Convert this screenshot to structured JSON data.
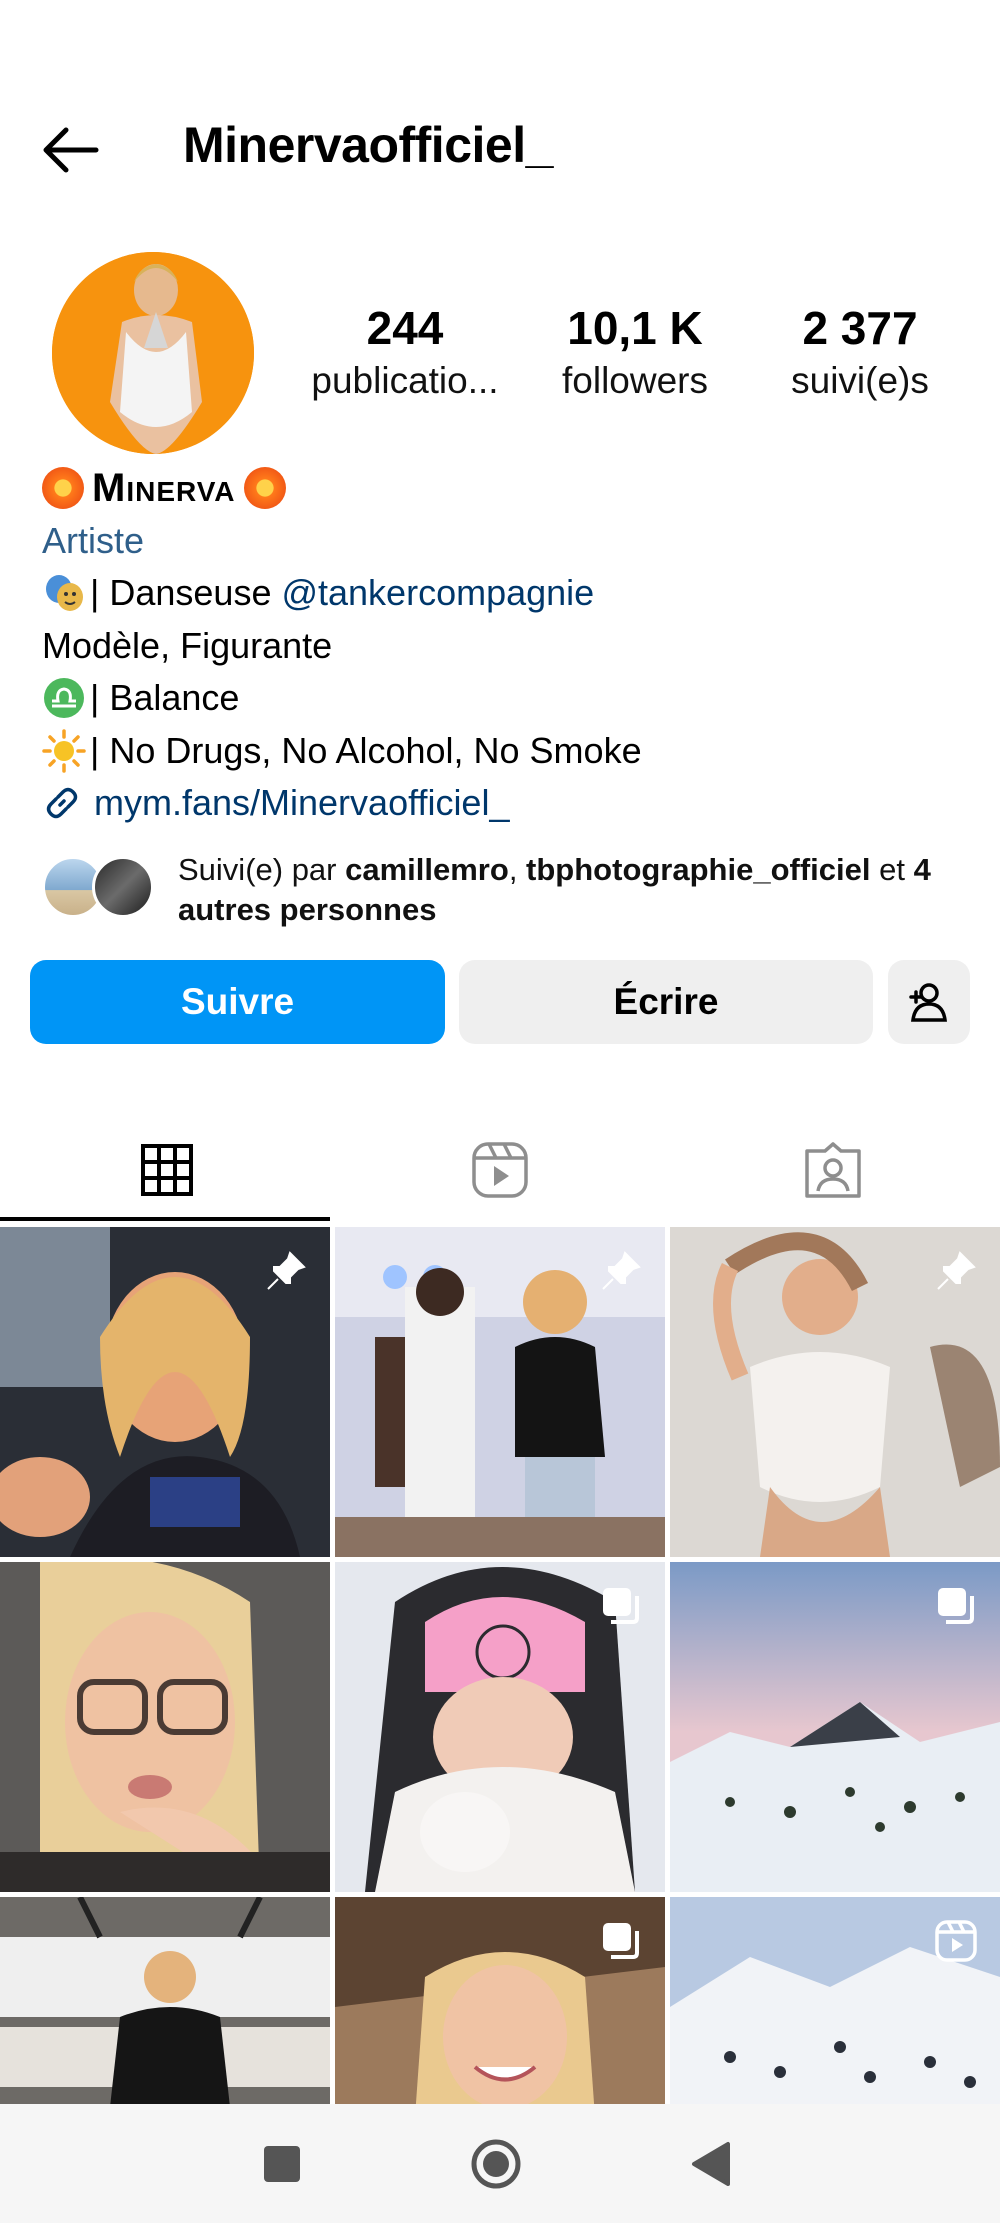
{
  "header": {
    "username": "Minervaofficiel_"
  },
  "stats": [
    {
      "value": "244",
      "label": "publicatio..."
    },
    {
      "value": "10,1 K",
      "label": "followers"
    },
    {
      "value": "2 377",
      "label": "suivi(e)s"
    }
  ],
  "bio": {
    "name": "Minerva",
    "category": "Artiste",
    "line1_text": "| Danseuse ",
    "line1_mention": "@tankercompagnie",
    "line2": "Modèle, Figurante",
    "line3": "| Balance",
    "line4": "| No Drugs, No Alcohol, No Smoke",
    "link": "mym.fans/Minervaofficiel_"
  },
  "followed_by": {
    "prefix": "Suivi(e) par ",
    "user1": "camillemro",
    "sep": ", ",
    "user2": "tbphotographie_officiel",
    "and": " et ",
    "others": "4 autres personnes"
  },
  "buttons": {
    "follow": "Suivre",
    "message": "Écrire"
  },
  "grid": [
    {
      "badge": "pin-icon"
    },
    {
      "badge": "pin-icon"
    },
    {
      "badge": "pin-icon"
    },
    {
      "badge": ""
    },
    {
      "badge": "carousel-icon"
    },
    {
      "badge": "carousel-icon"
    },
    {
      "badge": ""
    },
    {
      "badge": "carousel-icon"
    },
    {
      "badge": "reel-icon"
    }
  ],
  "colors": {
    "primary": "#0095f6",
    "link": "#00376b",
    "avatar_bg": "#f7930e"
  }
}
